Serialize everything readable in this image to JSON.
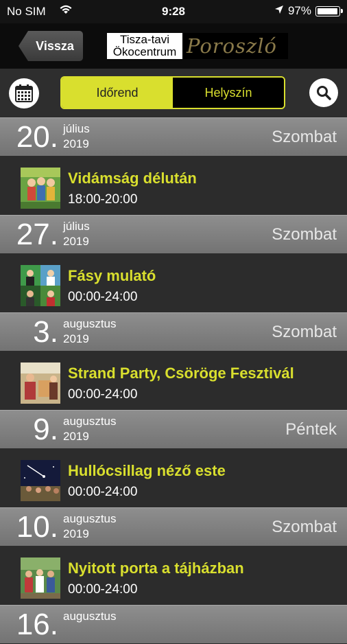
{
  "status_bar": {
    "carrier": "No SIM",
    "time": "9:28",
    "battery": "97%",
    "battery_level": 0.97
  },
  "nav": {
    "back_label": "Vissza",
    "logo_line1": "Tisza-tavi",
    "logo_line2": "Ökocentrum",
    "logo_script": "Poroszló"
  },
  "toolbar": {
    "tab_schedule": "Időrend",
    "tab_location": "Helyszín",
    "active_tab": "Időrend",
    "calendar_icon": "calendar-icon",
    "search_icon": "search-icon"
  },
  "colors": {
    "accent": "#d9df2e",
    "date_row": "#8a8a8a",
    "background": "#2c2c2c"
  },
  "days": [
    {
      "day": "20.",
      "month": "július",
      "year": "2019",
      "weekday": "Szombat",
      "event": {
        "title": "Vidámság délután",
        "time": "18:00-20:00"
      }
    },
    {
      "day": "27.",
      "month": "július",
      "year": "2019",
      "weekday": "Szombat",
      "event": {
        "title": "Fásy mulató",
        "time": "00:00-24:00"
      }
    },
    {
      "day": "3.",
      "month": "augusztus",
      "year": "2019",
      "weekday": "Szombat",
      "event": {
        "title": "Strand Party, Csöröge Fesztivál",
        "time": "00:00-24:00"
      }
    },
    {
      "day": "9.",
      "month": "augusztus",
      "year": "2019",
      "weekday": "Péntek",
      "event": {
        "title": "Hullócsillag néző este",
        "time": "00:00-24:00"
      }
    },
    {
      "day": "10.",
      "month": "augusztus",
      "year": "2019",
      "weekday": "Szombat",
      "event": {
        "title": "Nyitott porta a tájházban",
        "time": "00:00-24:00"
      }
    },
    {
      "day": "16.",
      "month": "augusztus",
      "year": "",
      "weekday": "",
      "event": null
    }
  ]
}
